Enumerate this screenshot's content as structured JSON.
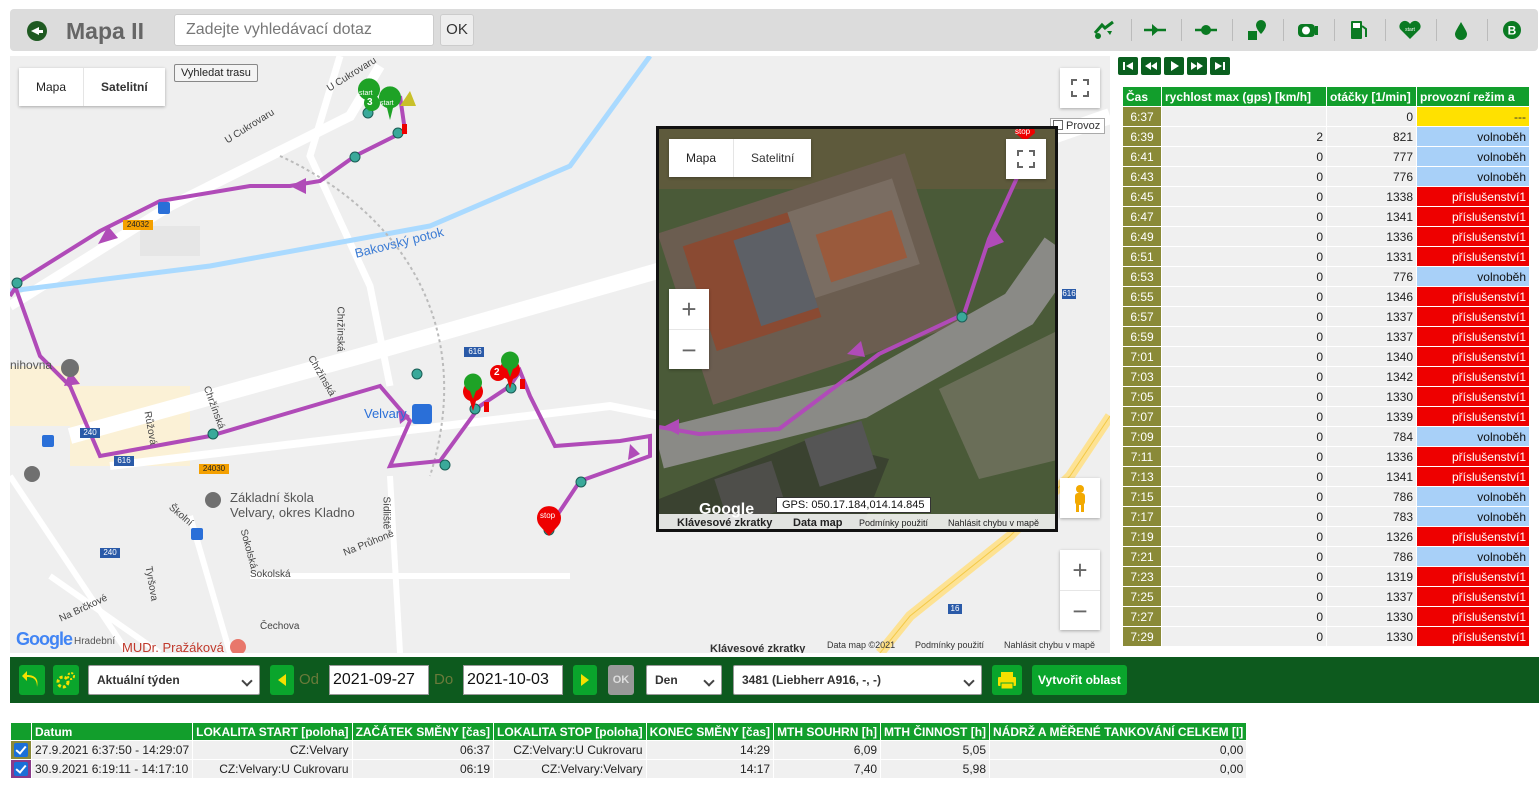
{
  "header": {
    "title": "Mapa II",
    "search_placeholder": "Zadejte vyhledávací dotaz",
    "ok_label": "OK",
    "icons": [
      "route-icon",
      "arrow-line-icon",
      "dot-line-icon",
      "wrench-pin-icon",
      "camera-icon",
      "fuel-pump-icon",
      "start-heart-icon",
      "drop-icon",
      "b-badge-icon"
    ]
  },
  "map": {
    "type_map": "Mapa",
    "type_satellite": "Satelitní",
    "route_button": "Vyhledat trasu",
    "provoz_label": "Provoz",
    "labels": {
      "u_cukrovaru_1": "U Cukrovaru",
      "u_cukrovaru_2": "U Cukrovaru",
      "bakovsky_potok": "Bakovský potok",
      "chrzinska_1": "Chržínská",
      "chrzinska_2": "Chržínská",
      "chrzinska_3": "Chržínská",
      "velvary": "Velvary",
      "knihovna": "nihovna",
      "ruzova": "Růžová",
      "skolni": "Školní",
      "zakladni_skola": "Základní škola",
      "zakladni_skola_2": "Velvary, okres Kladno",
      "sokolska_1": "Sokolská",
      "sokolska_2": "Sokolská",
      "tyrsova": "Tyršova",
      "na_bruckove": "Na Brčkové",
      "cechova": "Čechova",
      "na_pruhone": "Na Průhoně",
      "sidliste": "Sídliště",
      "hradebni": "Hradební",
      "mudr": "MUDr. Pražáková",
      "road_616_a": "616",
      "road_616_b": "616",
      "road_616_c": "616",
      "road_240_a": "240",
      "road_240_b": "240",
      "road_24030": "24030",
      "road_24032": "24032",
      "road_16": "16",
      "marker_3": "3",
      "marker_2": "2",
      "start": "start",
      "stop": "stop"
    },
    "footer": {
      "shortcuts": "Klávesové zkratky",
      "data": "Data map ©2021",
      "terms": "Podmínky použití",
      "report": "Nahlásit chybu v mapě"
    },
    "google": "Google"
  },
  "inset": {
    "type_map": "Mapa",
    "type_satellite": "Satelitní",
    "gps": "GPS: 050.17.184,014.14.845",
    "stop": "stop",
    "footer": {
      "shortcuts": "Klávesové zkratky",
      "data": "Data map",
      "terms": "Podmínky použití",
      "report": "Nahlásit chybu v mapě"
    },
    "google": "Google"
  },
  "data_table": {
    "headers": [
      "Čas",
      "rychlost max (gps) [km/h]",
      "otáčky [1/min]",
      "provozní režim a"
    ],
    "rows": [
      {
        "time": "6:37",
        "speed": "",
        "rpm": "0",
        "mode": "---",
        "mode_type": "y"
      },
      {
        "time": "6:39",
        "speed": "2",
        "rpm": "821",
        "mode": "volnoběh",
        "mode_type": "v"
      },
      {
        "time": "6:41",
        "speed": "0",
        "rpm": "777",
        "mode": "volnoběh",
        "mode_type": "v"
      },
      {
        "time": "6:43",
        "speed": "0",
        "rpm": "776",
        "mode": "volnoběh",
        "mode_type": "v"
      },
      {
        "time": "6:45",
        "speed": "0",
        "rpm": "1338",
        "mode": "příslušenství1",
        "mode_type": "p"
      },
      {
        "time": "6:47",
        "speed": "0",
        "rpm": "1341",
        "mode": "příslušenství1",
        "mode_type": "p"
      },
      {
        "time": "6:49",
        "speed": "0",
        "rpm": "1336",
        "mode": "příslušenství1",
        "mode_type": "p"
      },
      {
        "time": "6:51",
        "speed": "0",
        "rpm": "1331",
        "mode": "příslušenství1",
        "mode_type": "p"
      },
      {
        "time": "6:53",
        "speed": "0",
        "rpm": "776",
        "mode": "volnoběh",
        "mode_type": "v"
      },
      {
        "time": "6:55",
        "speed": "0",
        "rpm": "1346",
        "mode": "příslušenství1",
        "mode_type": "p"
      },
      {
        "time": "6:57",
        "speed": "0",
        "rpm": "1337",
        "mode": "příslušenství1",
        "mode_type": "p"
      },
      {
        "time": "6:59",
        "speed": "0",
        "rpm": "1337",
        "mode": "příslušenství1",
        "mode_type": "p"
      },
      {
        "time": "7:01",
        "speed": "0",
        "rpm": "1340",
        "mode": "příslušenství1",
        "mode_type": "p"
      },
      {
        "time": "7:03",
        "speed": "0",
        "rpm": "1342",
        "mode": "příslušenství1",
        "mode_type": "p"
      },
      {
        "time": "7:05",
        "speed": "0",
        "rpm": "1330",
        "mode": "příslušenství1",
        "mode_type": "p"
      },
      {
        "time": "7:07",
        "speed": "0",
        "rpm": "1339",
        "mode": "příslušenství1",
        "mode_type": "p"
      },
      {
        "time": "7:09",
        "speed": "0",
        "rpm": "784",
        "mode": "volnoběh",
        "mode_type": "v"
      },
      {
        "time": "7:11",
        "speed": "0",
        "rpm": "1336",
        "mode": "příslušenství1",
        "mode_type": "p"
      },
      {
        "time": "7:13",
        "speed": "0",
        "rpm": "1341",
        "mode": "příslušenství1",
        "mode_type": "p"
      },
      {
        "time": "7:15",
        "speed": "0",
        "rpm": "786",
        "mode": "volnoběh",
        "mode_type": "v"
      },
      {
        "time": "7:17",
        "speed": "0",
        "rpm": "783",
        "mode": "volnoběh",
        "mode_type": "v"
      },
      {
        "time": "7:19",
        "speed": "0",
        "rpm": "1326",
        "mode": "příslušenství1",
        "mode_type": "p"
      },
      {
        "time": "7:21",
        "speed": "0",
        "rpm": "786",
        "mode": "volnoběh",
        "mode_type": "v"
      },
      {
        "time": "7:23",
        "speed": "0",
        "rpm": "1319",
        "mode": "příslušenství1",
        "mode_type": "p"
      },
      {
        "time": "7:25",
        "speed": "0",
        "rpm": "1337",
        "mode": "příslušenství1",
        "mode_type": "p"
      },
      {
        "time": "7:27",
        "speed": "0",
        "rpm": "1330",
        "mode": "příslušenství1",
        "mode_type": "p"
      },
      {
        "time": "7:29",
        "speed": "0",
        "rpm": "1330",
        "mode": "příslušenství1",
        "mode_type": "p"
      }
    ]
  },
  "filter": {
    "period": "Aktuální týden",
    "from_label": "Od",
    "from_date": "2021-09-27",
    "to_label": "Do",
    "to_date": "2021-10-03",
    "ok_label": "OK",
    "granularity": "Den",
    "vehicle": "3481 (Liebherr A916, -, -)",
    "create_area": "Vytvořit oblast"
  },
  "shift_table": {
    "headers": [
      "Datum",
      "LOKALITA START [poloha]",
      "ZAČÁTEK SMĚNY [čas]",
      "LOKALITA STOP [poloha]",
      "KONEC SMĚNY [čas]",
      "MTH SOUHRN [h]",
      "MTH ČINNOST [h]",
      "NÁDRŽ A MĚŘENÉ TANKOVÁNÍ CELKEM [l]"
    ],
    "rows": [
      {
        "date": "27.9.2021 6:37:50 - 14:29:07",
        "loc_start": "CZ:Velvary",
        "start": "06:37",
        "loc_stop": "CZ:Velvary:U Cukrovaru",
        "end": "14:29",
        "mth_sum": "6,09",
        "mth_act": "5,05",
        "fuel": "0,00",
        "color": "#8a8a38"
      },
      {
        "date": "30.9.2021 6:19:11 - 14:17:10",
        "loc_start": "CZ:Velvary:U Cukrovaru",
        "start": "06:19",
        "loc_stop": "CZ:Velvary:Velvary",
        "end": "14:17",
        "mth_sum": "7,40",
        "mth_act": "5,98",
        "fuel": "0,00",
        "color": "#8a3a8a"
      }
    ]
  },
  "colors": {
    "brand_green": "#0aa52c",
    "dark_green": "#0d5a1e",
    "route_purple": "#b04bb8",
    "accessory_red": "#e00000",
    "idle_blue": "#a8d0f8",
    "unknown_yellow": "#ffe100"
  }
}
